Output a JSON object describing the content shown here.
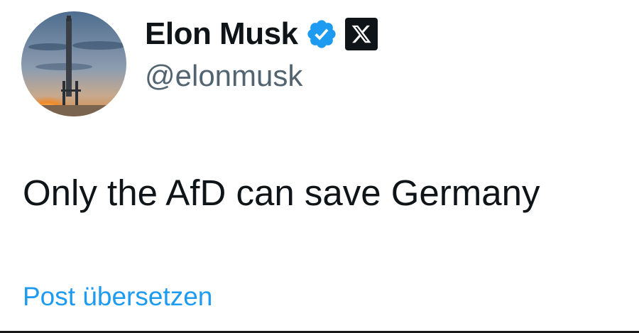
{
  "author": {
    "display_name": "Elon Musk",
    "handle": "@elonmusk",
    "verified_icon": "verified-badge-icon",
    "affiliate_icon": "x-logo-icon",
    "avatar": "avatar-rocket-launch"
  },
  "post": {
    "text": "Only the AfD can save Germany",
    "translate_label": "Post übersetzen"
  },
  "colors": {
    "text": "#0f1419",
    "secondary": "#536471",
    "link": "#1d9bf0",
    "verified": "#1d9bf0"
  }
}
